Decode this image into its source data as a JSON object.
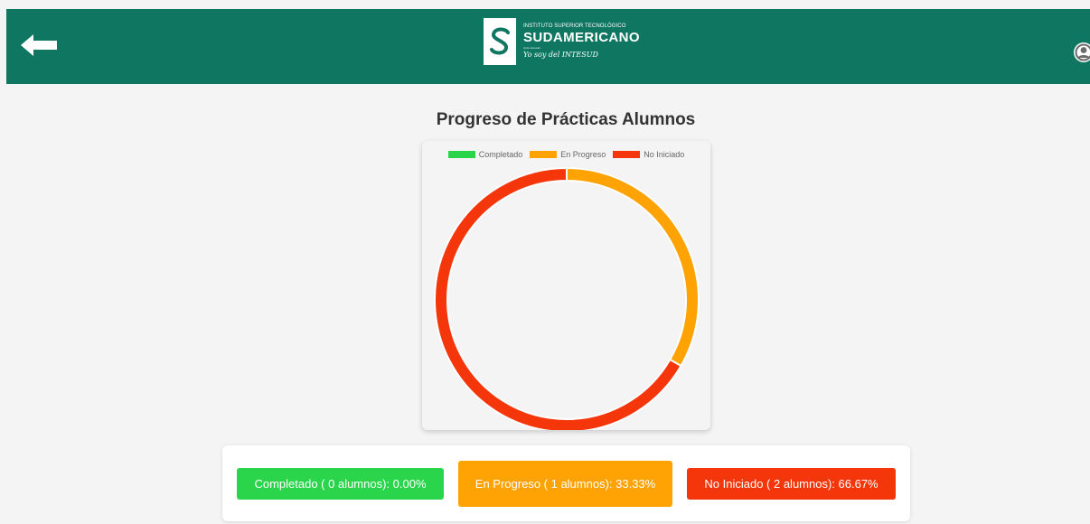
{
  "header": {
    "logo": {
      "institution_line": "INSTITUTO SUPERIOR TECNOLÓGICO",
      "name": "SUDAMERICANO",
      "small_line": "Quito Ecuador",
      "tagline": "Yo soy del INTESUD"
    },
    "icons": {
      "back": "arrow-left-icon",
      "profile": "user-avatar-icon"
    }
  },
  "main": {
    "title": "Progreso de Prácticas Alumnos"
  },
  "chart_data": {
    "type": "pie",
    "variant": "doughnut",
    "categories": [
      "Completado",
      "En Progreso",
      "No Iniciado"
    ],
    "values": [
      0,
      1,
      2
    ],
    "colors": [
      "#2bd54b",
      "#ffa305",
      "#f5360a"
    ],
    "legend_position": "top"
  },
  "summary": {
    "items": [
      {
        "text": "Completado ( 0 alumnos): 0.00%",
        "color": "#2bd54b"
      },
      {
        "text": "En Progreso ( 1 alumnos): 33.33%",
        "color": "#ffa305"
      },
      {
        "text": "No Iniciado ( 2 alumnos): 66.67%",
        "color": "#f5360a"
      }
    ]
  },
  "colors": {
    "header_bg": "#0f7661",
    "page_bg": "#f4f4f4",
    "title_text": "#333333"
  }
}
